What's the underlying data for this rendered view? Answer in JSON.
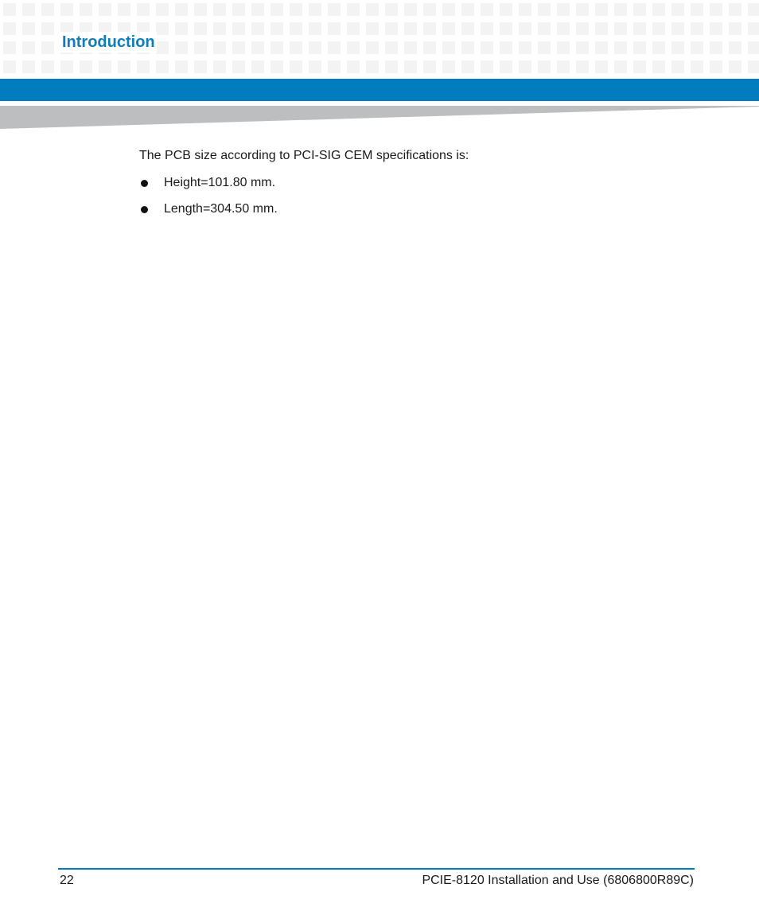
{
  "header": {
    "section_title": "Introduction",
    "brand_color": "#007cbf",
    "title_color": "#0e7dbd"
  },
  "body": {
    "intro": "The PCB size according to PCI-SIG CEM specifications is:",
    "bullets": [
      {
        "icon": "bullet-dot-icon",
        "text": "Height=101.80 mm."
      },
      {
        "icon": "bullet-dot-icon",
        "text": "Length=304.50 mm."
      }
    ]
  },
  "footer": {
    "page_number": "22",
    "document_title": "PCIE-8120 Installation and Use (6806800R89C)"
  }
}
